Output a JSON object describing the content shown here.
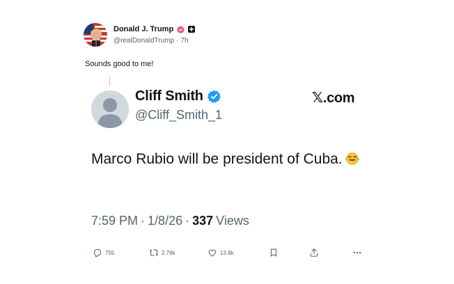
{
  "post": {
    "author": {
      "display_name": "Donald J. Trump",
      "handle": "@realDonaldTrump",
      "separator": "·",
      "time": "7h"
    },
    "text": "Sounds good to me!"
  },
  "embedded": {
    "display_name": "Cliff Smith",
    "handle": "@Cliff_Smith_1",
    "site": "𝕏.com",
    "body": "Marco Rubio will be president of Cuba.",
    "emoji_icon": "face-with-tears-of-joy-icon",
    "time": "7:59 PM",
    "sep1": "·",
    "date": "1/8/26",
    "sep2": "·",
    "views_count": "337",
    "views_label": "Views"
  },
  "actions": {
    "replies": "755",
    "reposts": "2.78k",
    "likes": "13.8k"
  },
  "colors": {
    "verified_pink": "#e8578b",
    "verified_blue": "#1d9bf0",
    "muted": "#536471",
    "text": "#0f1419"
  }
}
